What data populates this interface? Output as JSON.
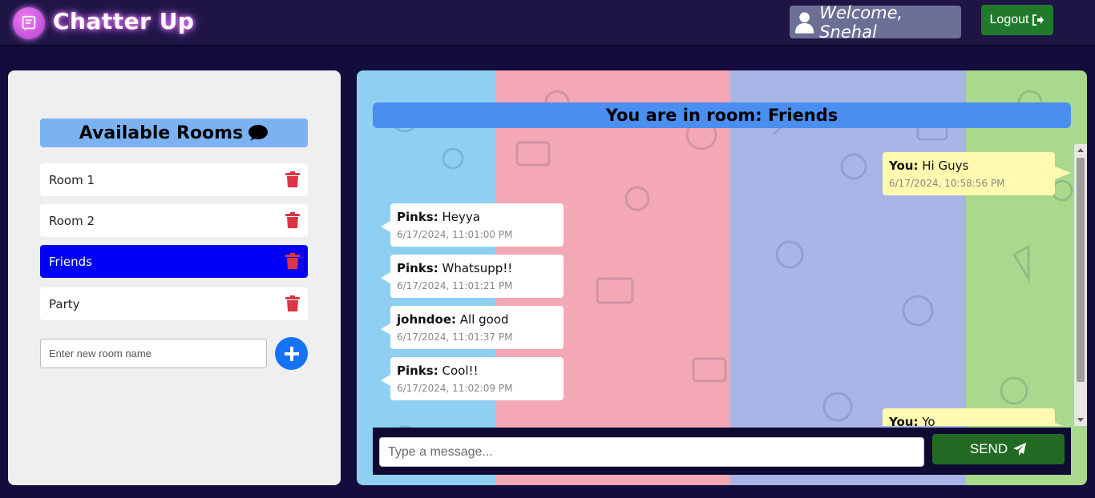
{
  "app": {
    "title": "Chatter Up",
    "welcome": "Welcome, Snehal",
    "logout_label": "Logout"
  },
  "sidebar": {
    "title": "Available Rooms",
    "rooms": [
      {
        "label": "Room 1",
        "active": false
      },
      {
        "label": "Room 2",
        "active": false
      },
      {
        "label": "Friends",
        "active": true
      },
      {
        "label": "Party",
        "active": false
      }
    ],
    "new_room_placeholder": "Enter new room name"
  },
  "chat": {
    "banner": "You are in room: Friends",
    "messages": [
      {
        "sender": "You:",
        "text": " Hi Guys",
        "time": "6/17/2024, 10:58:56 PM",
        "self": true
      },
      {
        "sender": "Pinks:",
        "text": " Heyya",
        "time": "6/17/2024, 11:01:00 PM",
        "self": false
      },
      {
        "sender": "Pinks:",
        "text": " Whatsupp!!",
        "time": "6/17/2024, 11:01:21 PM",
        "self": false
      },
      {
        "sender": "johndoe:",
        "text": " All good",
        "time": "6/17/2024, 11:01:37 PM",
        "self": false
      },
      {
        "sender": "Pinks:",
        "text": " Cool!!",
        "time": "6/17/2024, 11:02:09 PM",
        "self": false
      },
      {
        "sender": "You:",
        "text": " Yo",
        "time": "",
        "self": true
      }
    ],
    "input_placeholder": "Type a message...",
    "send_label": "SEND"
  },
  "colors": {
    "background": "#130d3e",
    "active_room": "#0000f5",
    "add_button": "#1574f5",
    "send_button": "#226a24",
    "logout_button": "#217a2c",
    "banner": "#4a8ef0"
  },
  "icons": {
    "brand": "chat-book-icon",
    "user": "user-icon",
    "logout": "sign-out-icon",
    "rooms": "comment-icon",
    "delete": "trash-icon",
    "add": "plus-icon",
    "send": "paper-plane-icon"
  }
}
